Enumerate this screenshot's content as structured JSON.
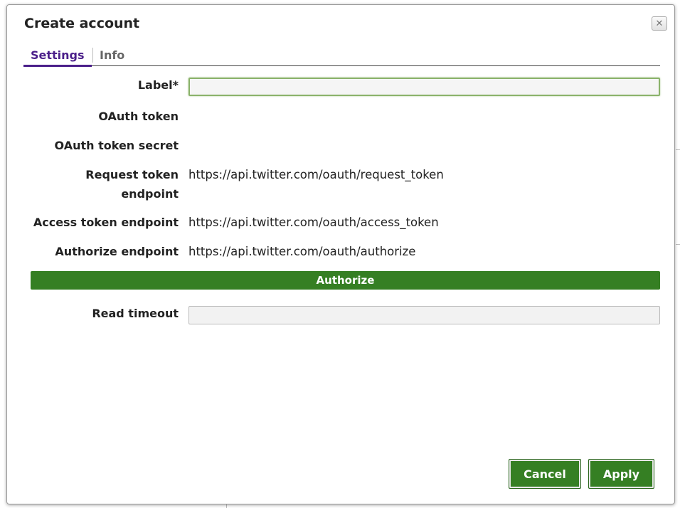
{
  "dialog": {
    "title": "Create account",
    "close_glyph": "✕"
  },
  "tabs": [
    {
      "label": "Settings",
      "active": true
    },
    {
      "label": "Info",
      "active": false
    }
  ],
  "fields": {
    "label": {
      "label": "Label*",
      "value": ""
    },
    "oauth_token": {
      "label": "OAuth token",
      "value": ""
    },
    "oauth_token_secret": {
      "label": "OAuth token secret",
      "value": ""
    },
    "request_token_endpoint": {
      "label_line1": "Request token",
      "label_line2": "endpoint",
      "value": "https://api.twitter.com/oauth/request_token"
    },
    "access_token_endpoint": {
      "label": "Access token endpoint",
      "value": "https://api.twitter.com/oauth/access_token"
    },
    "authorize_endpoint": {
      "label": "Authorize endpoint",
      "value": "https://api.twitter.com/oauth/authorize"
    },
    "read_timeout": {
      "label": "Read timeout",
      "value": ""
    }
  },
  "buttons": {
    "authorize": "Authorize",
    "cancel": "Cancel",
    "apply": "Apply"
  },
  "colors": {
    "accent_purple": "#4b1f8a",
    "button_green": "#357f23",
    "focus_green": "#8ab26a"
  },
  "icons": {
    "close": "close-icon"
  }
}
